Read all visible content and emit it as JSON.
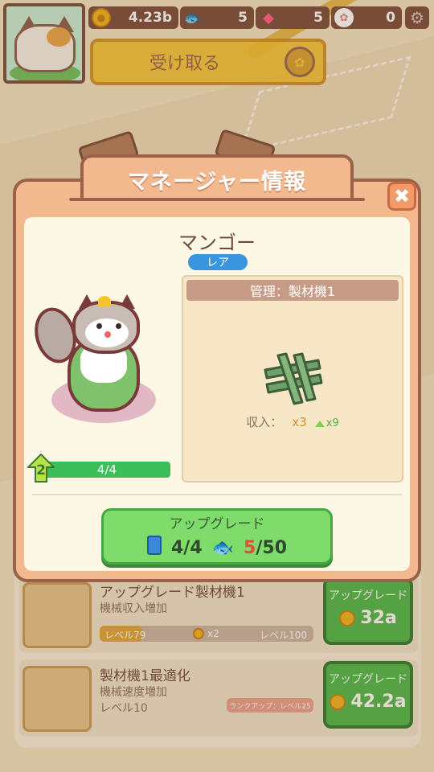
{
  "resources": {
    "coins": "4.23b",
    "fish": "5",
    "gems": "5",
    "paws": "0"
  },
  "header": {
    "receive_label": "受け取る"
  },
  "list": [
    {
      "title": "アップグレード製材機1",
      "subtitle": "機械収入増加",
      "level_left": "レベル79",
      "level_mid": "x2",
      "level_right": "レベル100",
      "level_progress": 0.2,
      "btn_label": "アップグレード",
      "btn_price": "32a"
    },
    {
      "title": "製材機1最適化",
      "subtitle": "機械速度増加",
      "level": "レベル10",
      "rank_chip": "ランクアップ：レベル25",
      "btn_label": "アップグレード",
      "btn_price": "42.2a"
    }
  ],
  "modal": {
    "title": "マネージャー情報",
    "manager_name": "マンゴー",
    "rarity": "レア",
    "level_badge": "2",
    "level_progress_text": "4/4",
    "manage_header": "管理：製材機1",
    "income_label": "収入：",
    "income_mult": "x3",
    "income_bonus": "x9",
    "upgrade": {
      "label": "アップグレード",
      "books": "4/4",
      "fish_have": "5",
      "fish_need": "/50"
    }
  },
  "colors": {
    "modal_frame": "#f3b98e",
    "modal_border": "#9a6248",
    "upgrade_green": "#7fdb6a",
    "rarity_blue": "#3a95e0"
  },
  "icons": [
    "coin-icon",
    "fish-icon",
    "gem-icon",
    "paw-icon",
    "gear-icon",
    "close-icon",
    "book-icon",
    "wood-planks-icon",
    "up-arrow-icon"
  ]
}
